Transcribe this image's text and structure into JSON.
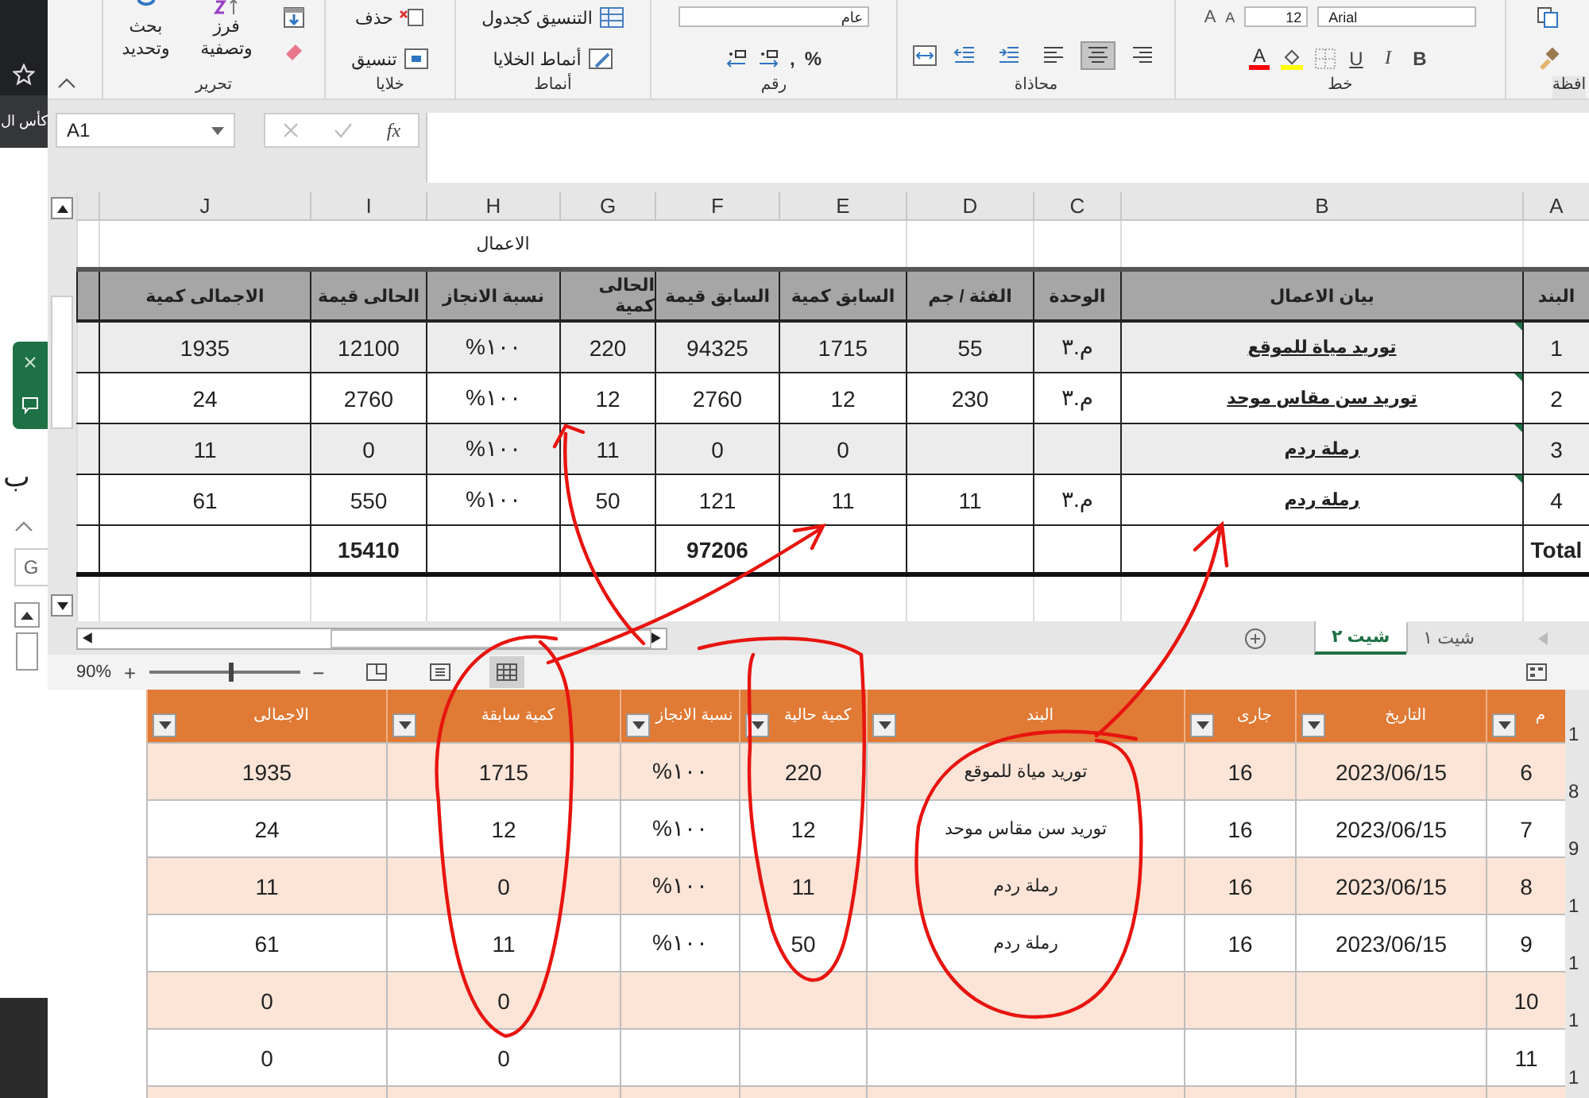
{
  "browser": {
    "bookmark": "كأس ال"
  },
  "side_panel": {
    "letter": "ب",
    "field": "G"
  },
  "ribbon": {
    "editing": {
      "label": "تحرير",
      "find": "بحث\nوتحديد",
      "sort": "فرز\nوتصفية"
    },
    "cells": {
      "label": "خلايا",
      "delete": "حذف",
      "format": "تنسيق"
    },
    "styles": {
      "label": "أنماط",
      "table": "التنسيق كجدول",
      "cell_styles": "أنماط الخلايا"
    },
    "number": {
      "label": "رقم",
      "format": "عام",
      "comma": ",",
      "percent": "%"
    },
    "alignment": {
      "label": "محاذاة",
      "buttons": [
        {
          "kind": "indent-decrease",
          "selected": false
        },
        {
          "kind": "indent-increase",
          "selected": false
        },
        {
          "kind": "align-left",
          "selected": false
        },
        {
          "kind": "align-center",
          "selected": true
        },
        {
          "kind": "align-right",
          "selected": false
        }
      ]
    },
    "font": {
      "label": "خط",
      "grow": "A",
      "shrink": "A",
      "size": "12",
      "name": "Arial",
      "color_button": "A",
      "underline": "U",
      "italic": "I",
      "bold": "B"
    },
    "clipboard": {
      "label": "افظة"
    }
  },
  "formula_bar": {
    "name_box": "A1",
    "fx": "fx"
  },
  "sheet": {
    "columns": [
      "A",
      "B",
      "C",
      "D",
      "E",
      "F",
      "G",
      "H",
      "I",
      "J"
    ],
    "title": "الاعمال",
    "headers": [
      "البند",
      "بيان الاعمال",
      "الوحدة",
      "الفئة / جم",
      "السابق كمية",
      "السابق قيمة",
      "الحالى كمية",
      "نسبة الانجاز",
      "الحالى قيمة",
      "الاجمالى كمية"
    ],
    "rows": [
      {
        "item": "1",
        "description": "توريد مياة للموقع",
        "unit": "م.٣",
        "rate": "55",
        "prev_qty": "1715",
        "prev_value": "94325",
        "cur_qty": "220",
        "percent": "%١٠٠",
        "cur_value": "12100",
        "total_qty": "1935"
      },
      {
        "item": "2",
        "description": "توريد سن مقاس موحد",
        "unit": "م.٣",
        "rate": "230",
        "prev_qty": "12",
        "prev_value": "2760",
        "cur_qty": "12",
        "percent": "%١٠٠",
        "cur_value": "2760",
        "total_qty": "24"
      },
      {
        "item": "3",
        "description": "رملة ردم",
        "prev_qty": "0",
        "prev_value": "0",
        "cur_qty": "11",
        "percent": "%١٠٠",
        "cur_value": "0",
        "total_qty": "11"
      },
      {
        "item": "4",
        "description": "رملة ردم",
        "unit": "م.٣",
        "rate": "11",
        "prev_qty": "11",
        "prev_value": "121",
        "cur_qty": "50",
        "percent": "%١٠٠",
        "cur_value": "550",
        "total_qty": "61"
      }
    ],
    "total": {
      "item": "Total",
      "prev_value": "97206",
      "cur_value": "15410"
    }
  },
  "sheet_tabs": [
    {
      "label": "شيت ١",
      "selected": false
    },
    {
      "label": "شيت ٢",
      "selected": true
    }
  ],
  "zoom": {
    "percent": "90%",
    "plus": "+",
    "minus": "−",
    "level": 0.53
  },
  "list": {
    "headers": [
      "م",
      "التاريخ",
      "جارى",
      "البند",
      "كمية حالية",
      "نسبة الانجاز",
      "كمية سابقة",
      "الاجمالى"
    ],
    "rows": [
      {
        "no": "6",
        "date": "2023/06/15",
        "current": "16",
        "item": "توريد مياة للموقع",
        "cur_qty": "220",
        "percent": "%١٠٠",
        "prev_qty": "1715",
        "total": "1935"
      },
      {
        "no": "7",
        "date": "2023/06/15",
        "current": "16",
        "item": "توريد سن مقاس موحد",
        "cur_qty": "12",
        "percent": "%١٠٠",
        "prev_qty": "12",
        "total": "24"
      },
      {
        "no": "8",
        "date": "2023/06/15",
        "current": "16",
        "item": "رملة ردم",
        "cur_qty": "11",
        "percent": "%١٠٠",
        "prev_qty": "0",
        "total": "11"
      },
      {
        "no": "9",
        "date": "2023/06/15",
        "current": "16",
        "item": "رملة ردم",
        "cur_qty": "50",
        "percent": "%١٠٠",
        "prev_qty": "11",
        "total": "61"
      },
      {
        "no": "10",
        "prev_qty": "0",
        "total": "0"
      },
      {
        "no": "11",
        "prev_qty": "0",
        "total": "0"
      }
    ],
    "row_numbers": [
      "1",
      "8",
      "9",
      "1",
      "1",
      "1",
      "1"
    ]
  }
}
